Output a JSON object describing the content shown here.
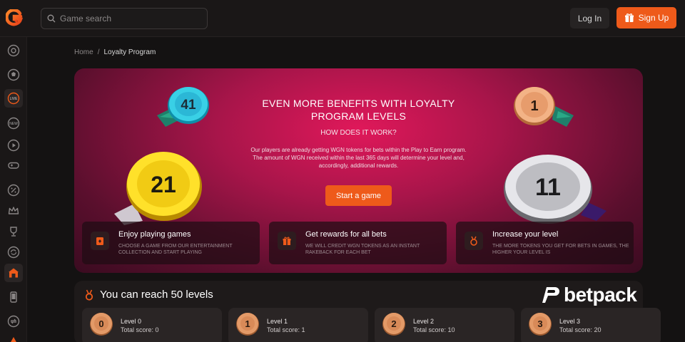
{
  "header": {
    "logo_icon": "g-logo-icon",
    "search": {
      "placeholder": "Game search",
      "value": ""
    },
    "login_label": "Log In",
    "signup_label": "Sign Up",
    "accent": "#ee5a1a"
  },
  "sidebar": {
    "items": [
      {
        "icon": "roulette-icon"
      },
      {
        "icon": "soccer-ball-icon"
      },
      {
        "icon": "live-icon",
        "label": "LIVE"
      },
      {
        "icon": "new-icon",
        "label": "NEW"
      },
      {
        "icon": "play-icon"
      },
      {
        "icon": "gamepad-icon"
      },
      {
        "icon": "percent-icon"
      },
      {
        "icon": "crown-icon"
      },
      {
        "icon": "trophy-icon"
      },
      {
        "icon": "refresh-icon"
      },
      {
        "icon": "loyalty-icon"
      },
      {
        "icon": "mobile-icon"
      },
      {
        "icon": "exchange-icon"
      }
    ]
  },
  "breadcrumb": {
    "home": "Home",
    "separator": "/",
    "current": "Loyalty Program"
  },
  "hero": {
    "title_line1": "EVEN MORE BENEFITS WITH LOYALTY",
    "title_line2": "PROGRAM LEVELS",
    "subtitle": "HOW DOES IT WORK?",
    "description": "Our players are already getting WGN tokens for bets within the Play to Earn program. The amount of WGN received within the last 365 days will determine your level and, accordingly, additional rewards.",
    "cta": "Start a game",
    "medals": [
      "41",
      "21",
      "1",
      "11"
    ]
  },
  "features": [
    {
      "icon": "cards-icon",
      "title": "Enjoy playing games",
      "desc": "CHOOSE A GAME FROM OUR ENTERTAINMENT COLLECTION AND START PLAYING"
    },
    {
      "icon": "gift-icon",
      "title": "Get rewards for all bets",
      "desc": "WE WILL CREDIT WGN TOKENS AS AN INSTANT RAKEBACK FOR EACH BET"
    },
    {
      "icon": "medal-icon",
      "title": "Increase your level",
      "desc": "THE MORE TOKENS YOU GET FOR BETS IN GAMES, THE HIGHER YOUR LEVEL IS"
    }
  ],
  "levels": {
    "title": "You can reach 50 levels",
    "cards": [
      {
        "coin": "0",
        "name": "Level 0",
        "score": "Total score:  0"
      },
      {
        "coin": "1",
        "name": "Level 1",
        "score": "Total score:  1"
      },
      {
        "coin": "2",
        "name": "Level 2",
        "score": "Total score:  10"
      },
      {
        "coin": "3",
        "name": "Level 3",
        "score": "Total score:  20"
      }
    ]
  },
  "watermark": {
    "text": "betpack"
  }
}
